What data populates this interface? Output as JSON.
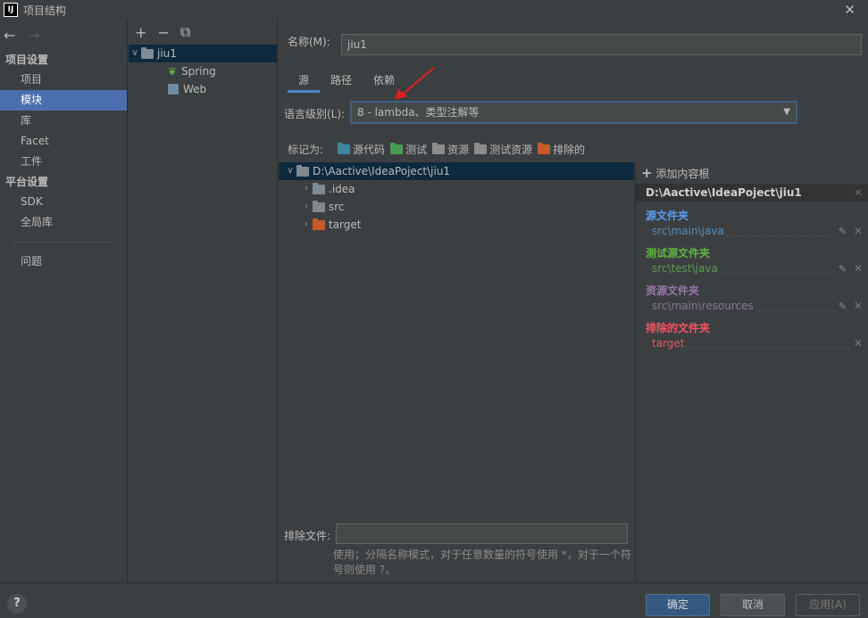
{
  "window": {
    "title": "项目结构",
    "app_icon_text": "IJ"
  },
  "nav": {
    "sections": [
      {
        "label": "项目设置",
        "items": [
          "项目",
          "模块",
          "库",
          "Facet",
          "工件"
        ]
      },
      {
        "label": "平台设置",
        "items": [
          "SDK",
          "全局库"
        ]
      }
    ],
    "problems": "问题",
    "selected": "模块"
  },
  "modules": {
    "root": "jiu1",
    "children": [
      "Spring",
      "Web"
    ]
  },
  "main": {
    "name_label": "名称(M):",
    "name_value": "jiu1",
    "tabs": [
      "源",
      "路径",
      "依赖"
    ],
    "active_tab": "源",
    "lang_label": "语言级别(L):",
    "lang_value": "8 - lambda、类型注解等",
    "mark_as_label": "标记为:",
    "mark_as": [
      {
        "label": "源代码",
        "color": "#3e86a0"
      },
      {
        "label": "测试",
        "color": "#499c54"
      },
      {
        "label": "资源",
        "color": "#8c8c8c"
      },
      {
        "label": "测试资源",
        "color": "#8c8c8c"
      },
      {
        "label": "排除的",
        "color": "#c65a2b"
      }
    ],
    "tree_root": "D:\\Aactive\\IdeaPoject\\jiu1",
    "tree_children": [
      ".idea",
      "src",
      "target"
    ],
    "exclude_label": "排除文件:",
    "exclude_value": "",
    "hint": "使用；分隔名称模式，对于任意数量的符号使用 *，对于一个符号则使用 ?。"
  },
  "roots": {
    "add_label": "添加内容根",
    "path": "D:\\Aactive\\IdeaPoject\\jiu1",
    "groups": [
      {
        "title": "源文件夹",
        "path": "src\\main\\java",
        "color": "#589df6",
        "path_color": "#4f8fbf"
      },
      {
        "title": "测试源文件夹",
        "path": "src\\test\\java",
        "color": "#62b543",
        "path_color": "#5c9a54"
      },
      {
        "title": "资源文件夹",
        "path": "src\\main\\resources",
        "color": "#9876aa",
        "path_color": "#8a7496"
      },
      {
        "title": "排除的文件夹",
        "path": "target",
        "color": "#f75464",
        "path_color": "#e05a5a"
      }
    ]
  },
  "buttons": {
    "ok": "确定",
    "cancel": "取消",
    "apply": "应用(A)",
    "help": "?"
  }
}
